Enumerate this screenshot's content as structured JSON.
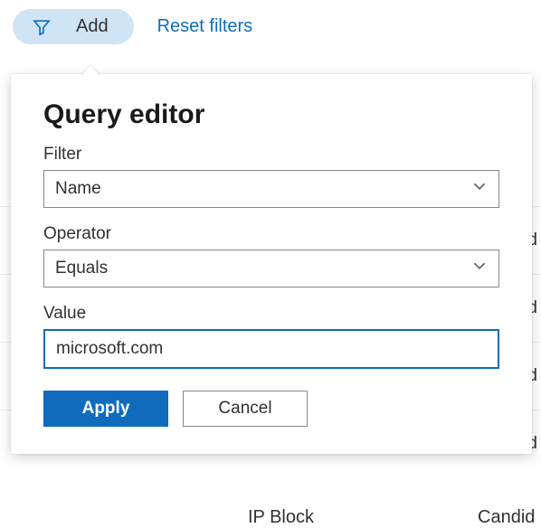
{
  "toolbar": {
    "add_label": "Add",
    "reset_label": "Reset filters"
  },
  "popover": {
    "title": "Query editor",
    "filter_label": "Filter",
    "filter_value": "Name",
    "operator_label": "Operator",
    "operator_value": "Equals",
    "value_label": "Value",
    "value_input": "microsoft.com",
    "apply_label": "Apply",
    "cancel_label": "Cancel"
  },
  "background": {
    "row_fragment": "d",
    "footer_left": "IP Block",
    "footer_right": "Candid"
  }
}
